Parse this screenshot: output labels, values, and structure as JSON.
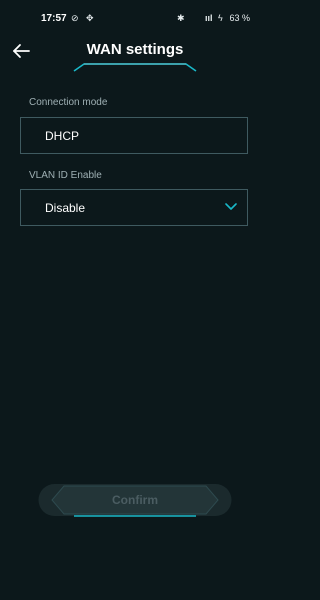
{
  "status_bar": {
    "time": "17:57",
    "battery": "63 %"
  },
  "header": {
    "title": "WAN settings",
    "back_icon": "arrow-left-icon"
  },
  "form": {
    "connection_mode_label": "Connection mode",
    "connection_mode_value": "DHCP",
    "vlan_label": "VLAN ID Enable",
    "vlan_value": "Disable",
    "vlan_icon": "chevron-down-icon"
  },
  "confirm_button": {
    "label": "Confirm",
    "enabled": false
  },
  "colors": {
    "background": "#0c181b",
    "accent": "#19b8c8",
    "border": "#3f5a60",
    "label": "#9fb0b4",
    "disabled_text": "#4b5d62"
  }
}
